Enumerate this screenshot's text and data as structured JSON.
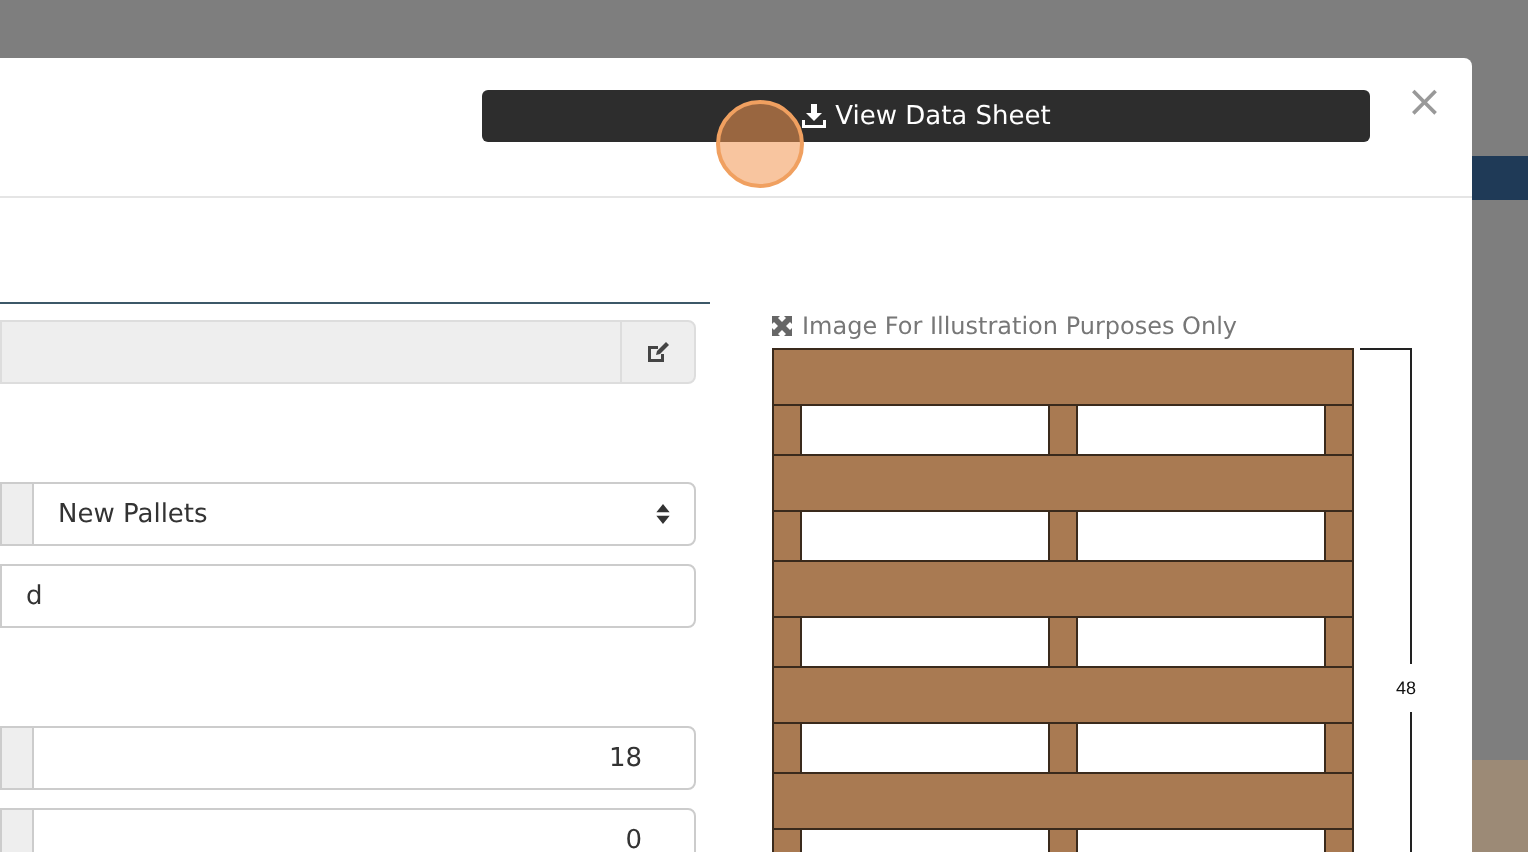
{
  "header": {
    "button": "View Data Sheet",
    "close": "×"
  },
  "groups": [
    {
      "fields": [
        {
          "kind": "locked"
        }
      ]
    },
    {
      "fields": [
        {
          "kind": "select",
          "value": "New Pallets"
        },
        {
          "kind": "text",
          "value": "d"
        }
      ]
    },
    {
      "fields": [
        {
          "kind": "number",
          "value": "18"
        },
        {
          "kind": "number",
          "value": "0"
        }
      ]
    }
  ],
  "image": {
    "caption": "Image For Illustration Purposes Only",
    "dimension": "48"
  }
}
